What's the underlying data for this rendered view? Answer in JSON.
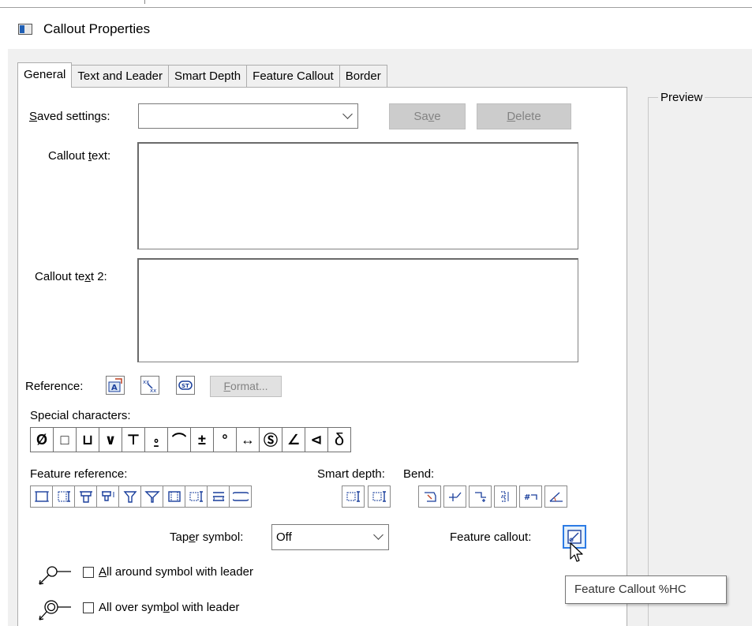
{
  "window": {
    "title": "Callout Properties",
    "icon": "dialog-app-icon"
  },
  "tabs": [
    {
      "label": "General",
      "active": true
    },
    {
      "label": "Text and Leader",
      "active": false
    },
    {
      "label": "Smart Depth",
      "active": false
    },
    {
      "label": "Feature Callout",
      "active": false
    },
    {
      "label": "Border",
      "active": false
    }
  ],
  "general": {
    "saved_settings": {
      "label_u": "S",
      "label_rest": "aved settings:",
      "value": ""
    },
    "save_button": {
      "pre": "Sa",
      "u": "v",
      "post": "e"
    },
    "delete_button": {
      "pre": "",
      "u": "D",
      "post": "elete"
    },
    "callout_text": {
      "pre": "Callout ",
      "u": "t",
      "post": "ext:",
      "value": ""
    },
    "callout_text2": {
      "pre": "Callout te",
      "u": "x",
      "post": "t 2:",
      "value": ""
    },
    "reference": {
      "label": "Reference:",
      "buttons": [
        "attribute-icon",
        "dimension-value-icon",
        "style-text-icon"
      ],
      "format": {
        "u": "F",
        "post": "ormat..."
      }
    },
    "special_characters": {
      "label": "Special characters:",
      "chars": [
        "Ø",
        "□",
        "⊔",
        "∨",
        "⊤",
        "⍛",
        "⌒",
        "±",
        "°",
        "↔",
        "Ⓢ",
        "∠",
        "⊲",
        "δ"
      ]
    },
    "feature_reference": {
      "label": "Feature reference:",
      "count": 10
    },
    "smart_depth": {
      "label": "Smart depth:",
      "count": 2
    },
    "bend": {
      "label": "Bend:",
      "count": 6
    },
    "taper_symbol": {
      "pre": "Tap",
      "u": "e",
      "post": "r symbol:",
      "value": "Off"
    },
    "feature_callout": {
      "label": "Feature callout:"
    },
    "all_around": {
      "u": "A",
      "post": "ll around symbol with leader",
      "checked": false
    },
    "all_over": {
      "pre": "All over sym",
      "u": "b",
      "post": "ol with leader",
      "checked": false
    }
  },
  "preview": {
    "label": "Preview"
  },
  "tooltip": {
    "text": "Feature Callout %HC"
  },
  "colors": {
    "accent": "#1a3f9c",
    "dialog_bg": "#f0f0f0",
    "disabled_button": "#cccccc"
  }
}
